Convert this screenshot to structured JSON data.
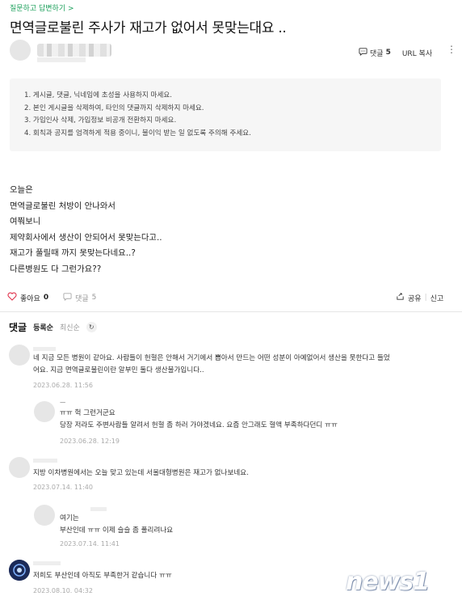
{
  "breadcrumb": "질문하고 답변하기 >",
  "title": "면역글로불린 주사가 재고가 없어서 못맞는대요 ..",
  "meta": {
    "comment_label": "댓글",
    "comment_count": "5",
    "url_copy": "URL 복사"
  },
  "notice": [
    "1. 게시글, 댓글, 닉네임에 초성을 사용하지 마세요.",
    "2. 본인 게시글을 삭제하여, 타인의 댓글까지 삭제하지 마세요.",
    "3. 가입인사 삭제, 가입정보 비공개 전환하지 마세요.",
    "4. 회칙과 공지를 엄격하게 적용 중이니, 불이익 받는 일 없도록 주의해 주세요."
  ],
  "content": [
    "오늘은",
    "면역글로불린 처방이 안나와서",
    "여쭤보니",
    "제약회사에서 생산이 안되어서 못맞는다고..",
    "재고가 풀릴때 까지 못맞는다네요..?",
    "다른병원도 다 그런가요??"
  ],
  "actions": {
    "like_label": "좋아요",
    "like_count": "0",
    "comment_label": "댓글",
    "comment_count": "5",
    "share": "공유",
    "report": "신고"
  },
  "comments_header": {
    "title": "댓글",
    "sort_registered": "등록순",
    "sort_latest": "최신순"
  },
  "comments": [
    {
      "text1": "네 지금 모든 병원이 같아요. 사람들이 헌혈은 안해서 거기에서 뽑아서 만드는 어떤 성분이 아예없어서 생산을 못한다고 들었",
      "text2": "어요. 지금 면역글로불린이란 알부민 둘다 생산불가입니다..",
      "date": "2023.06.28. 11:56"
    },
    {
      "name": "ㅡ",
      "text1": "ㅠㅠ 헉 그런거군요",
      "text2": "당장 저라도 주변사람들 알려서 헌혈 좀 하러 가야겠네요. 요즘 안그래도 혈액 부족하다던디 ㅠㅠ",
      "date": "2023.06.28. 12:19"
    },
    {
      "text1": "지방 이차병원에서는 오늘 맞고 있는데 서울대형병원은 재고가 없나보네요.",
      "date": "2023.07.14. 11:40"
    },
    {
      "text1": "여기는",
      "text2": "부산인데 ㅠㅠ 이제 슬슬 좀 풀리려나요",
      "date": "2023.07.14. 11:41"
    },
    {
      "text1": "저희도 부산인데 아직도 부족한거 같습니다 ㅠㅠ",
      "date": "2023.08.10. 04:32"
    }
  ],
  "logo": "news1"
}
